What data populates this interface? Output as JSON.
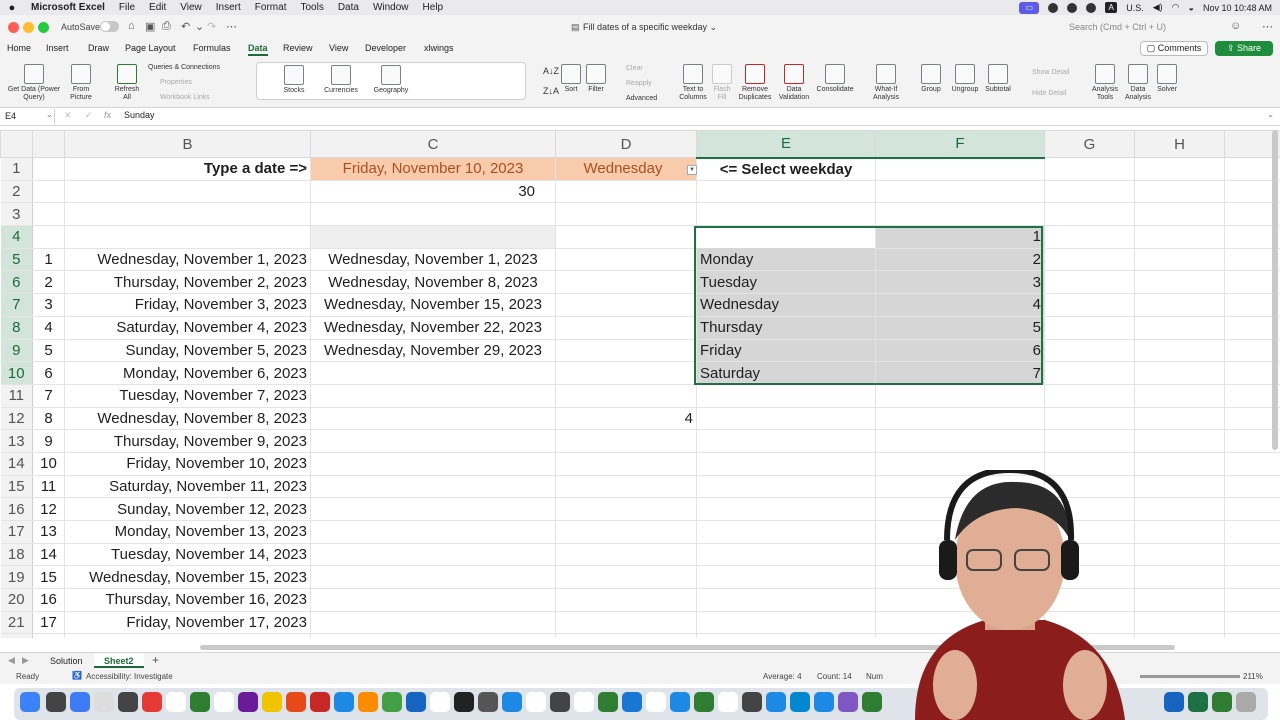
{
  "menubar": {
    "app": "Microsoft Excel",
    "items": [
      "File",
      "Edit",
      "View",
      "Insert",
      "Format",
      "Tools",
      "Data",
      "Window",
      "Help"
    ],
    "input_label": "U.S.",
    "clock": "Nov 10  10:48 AM"
  },
  "titlebar": {
    "autosave_label": "AutoSave",
    "doc_title": "Fill dates of a specific weekday ⌄",
    "search_placeholder": "Search (Cmd + Ctrl + U)"
  },
  "tabs": [
    "Home",
    "Insert",
    "Draw",
    "Page Layout",
    "Formulas",
    "Data",
    "Review",
    "View",
    "Developer",
    "xlwings"
  ],
  "active_tab": "Data",
  "comments_label": "Comments",
  "share_label": "Share",
  "ribbon": {
    "get_data": "Get Data (Power Query)",
    "from_picture": "From Picture",
    "refresh_all": "Refresh All",
    "queries": "Queries & Connections",
    "properties": "Properties",
    "workbook_links": "Workbook Links",
    "stocks": "Stocks",
    "currencies": "Currencies",
    "geography": "Geography",
    "sort": "Sort",
    "filter": "Filter",
    "clear": "Clear",
    "reapply": "Reapply",
    "advanced": "Advanced",
    "text_to_columns": "Text to Columns",
    "flash_fill": "Flash Fill",
    "remove_duplicates": "Remove Duplicates",
    "data_validation": "Data Validation",
    "consolidate": "Consolidate",
    "what_if": "What-If Analysis",
    "group": "Group",
    "ungroup": "Ungroup",
    "subtotal": "Subtotal",
    "show_detail": "Show Detail",
    "hide_detail": "Hide Detail",
    "analysis_tools": "Analysis Tools",
    "data_analysis": "Data Analysis",
    "solver": "Solver"
  },
  "formula_bar": {
    "cell_ref": "E4",
    "fx": "fx",
    "content": "Sunday"
  },
  "columns": [
    "B",
    "C",
    "D",
    "E",
    "F",
    "G",
    "H"
  ],
  "cells": {
    "B1": "Type a date =>",
    "C1": "Friday, November 10, 2023",
    "D1": "Wednesday",
    "E1": "<= Select weekday",
    "C2": "30",
    "D12": "4"
  },
  "rows_a": [
    1,
    2,
    3,
    4,
    5,
    6,
    7,
    8,
    9,
    10,
    11,
    12,
    13,
    14,
    15,
    16,
    17
  ],
  "dates_b": [
    "Wednesday, November 1, 2023",
    "Thursday, November 2, 2023",
    "Friday, November 3, 2023",
    "Saturday, November 4, 2023",
    "Sunday, November 5, 2023",
    "Monday, November 6, 2023",
    "Tuesday, November 7, 2023",
    "Wednesday, November 8, 2023",
    "Thursday, November 9, 2023",
    "Friday, November 10, 2023",
    "Saturday, November 11, 2023",
    "Sunday, November 12, 2023",
    "Monday, November 13, 2023",
    "Tuesday, November 14, 2023",
    "Wednesday, November 15, 2023",
    "Thursday, November 16, 2023",
    "Friday, November 17, 2023"
  ],
  "dates_c": [
    "Wednesday, November 1, 2023",
    "Wednesday, November 8, 2023",
    "Wednesday, November 15, 2023",
    "Wednesday, November 22, 2023",
    "Wednesday, November 29, 2023"
  ],
  "weekdays": [
    {
      "name": "Sunday",
      "num": "1"
    },
    {
      "name": "Monday",
      "num": "2"
    },
    {
      "name": "Tuesday",
      "num": "3"
    },
    {
      "name": "Wednesday",
      "num": "4"
    },
    {
      "name": "Thursday",
      "num": "5"
    },
    {
      "name": "Friday",
      "num": "6"
    },
    {
      "name": "Saturday",
      "num": "7"
    }
  ],
  "sheets": [
    "Solution",
    "Sheet2"
  ],
  "active_sheet": "Sheet2",
  "status": {
    "mode": "Ready",
    "accessibility": "Accessibility: Investigate",
    "average": "Average: 4",
    "count": "Count: 14",
    "numeric_partial": "Num",
    "zoom": "211%"
  },
  "colors": {
    "accent": "#1e7145",
    "orange_fill": "#f8cbad",
    "share": "#1e8e3e"
  }
}
